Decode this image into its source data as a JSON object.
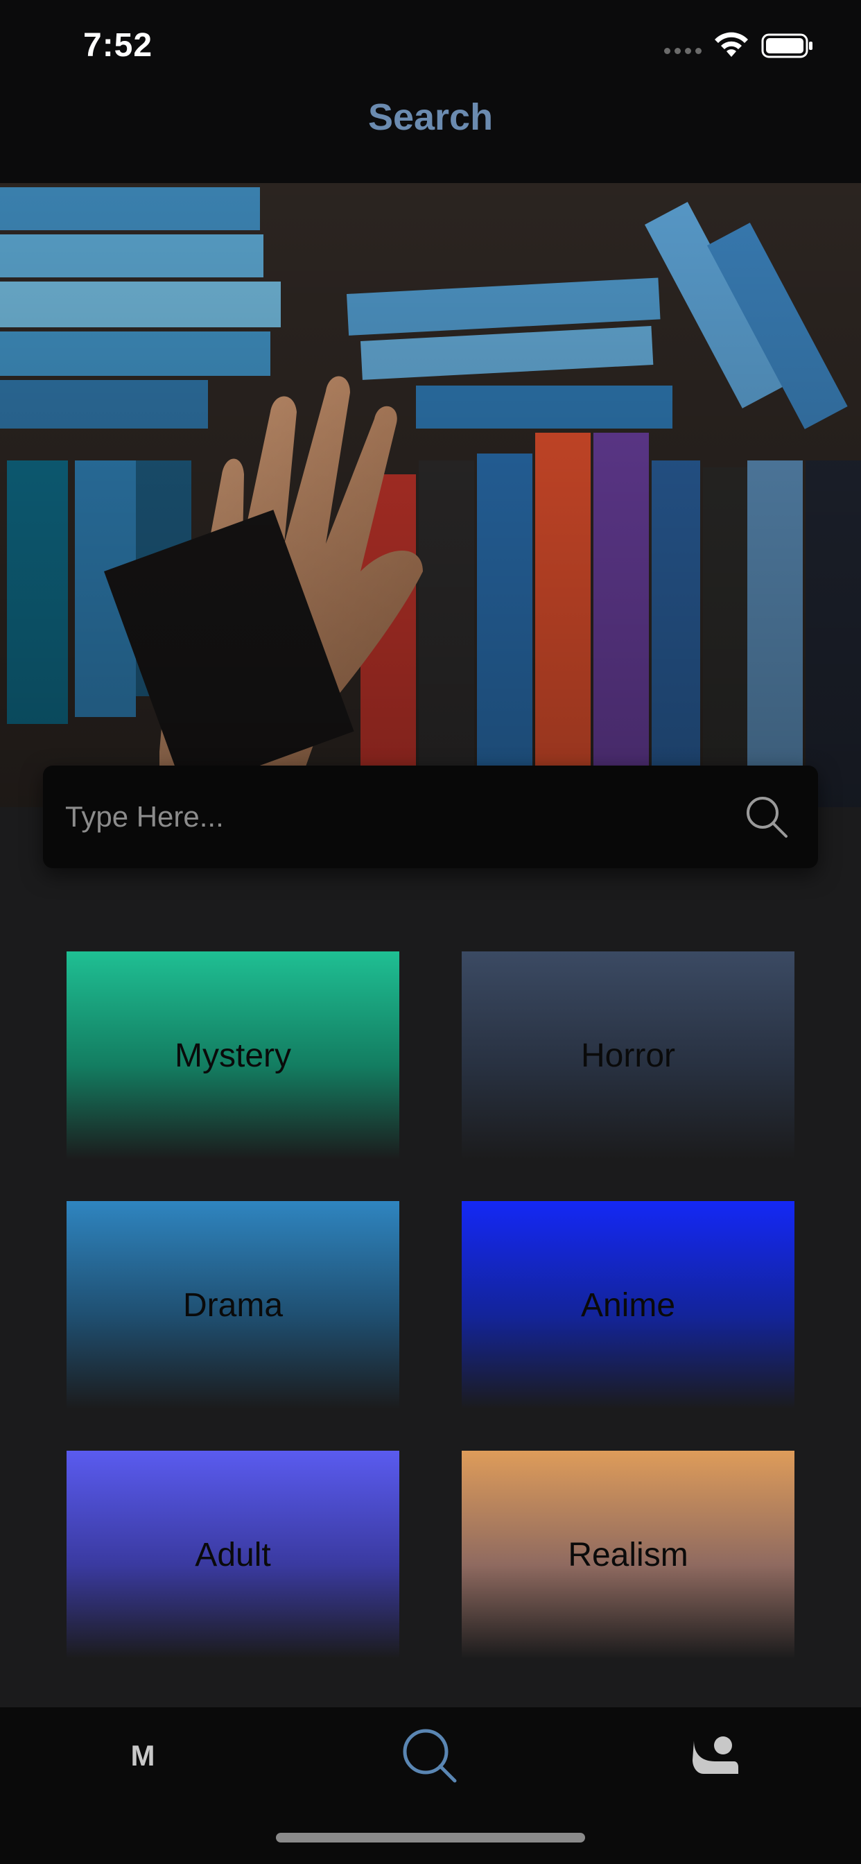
{
  "status_bar": {
    "time": "7:52",
    "icons": [
      "signal-dots-icon",
      "wifi-icon",
      "battery-icon"
    ]
  },
  "header": {
    "title": "Search",
    "title_color": "#6b8bb0"
  },
  "hero": {
    "description_icon": "vhs-tapes-photo"
  },
  "search": {
    "placeholder": "Type Here...",
    "value": "",
    "icon": "search-icon"
  },
  "genres": [
    {
      "label": "Mystery",
      "color": "#1fbf93"
    },
    {
      "label": "Horror",
      "color": "#3b4a63"
    },
    {
      "label": "Drama",
      "color": "#2f85c0"
    },
    {
      "label": "Anime",
      "color": "#1428f5"
    },
    {
      "label": "Adult",
      "color": "#5a5bef"
    },
    {
      "label": "Realism",
      "color": "#de9c5a"
    }
  ],
  "tab_bar": {
    "home_label": "M",
    "active_tab": "search",
    "active_color": "#5a86b3",
    "icons": [
      "m-icon",
      "search-icon",
      "profile-icon"
    ]
  }
}
